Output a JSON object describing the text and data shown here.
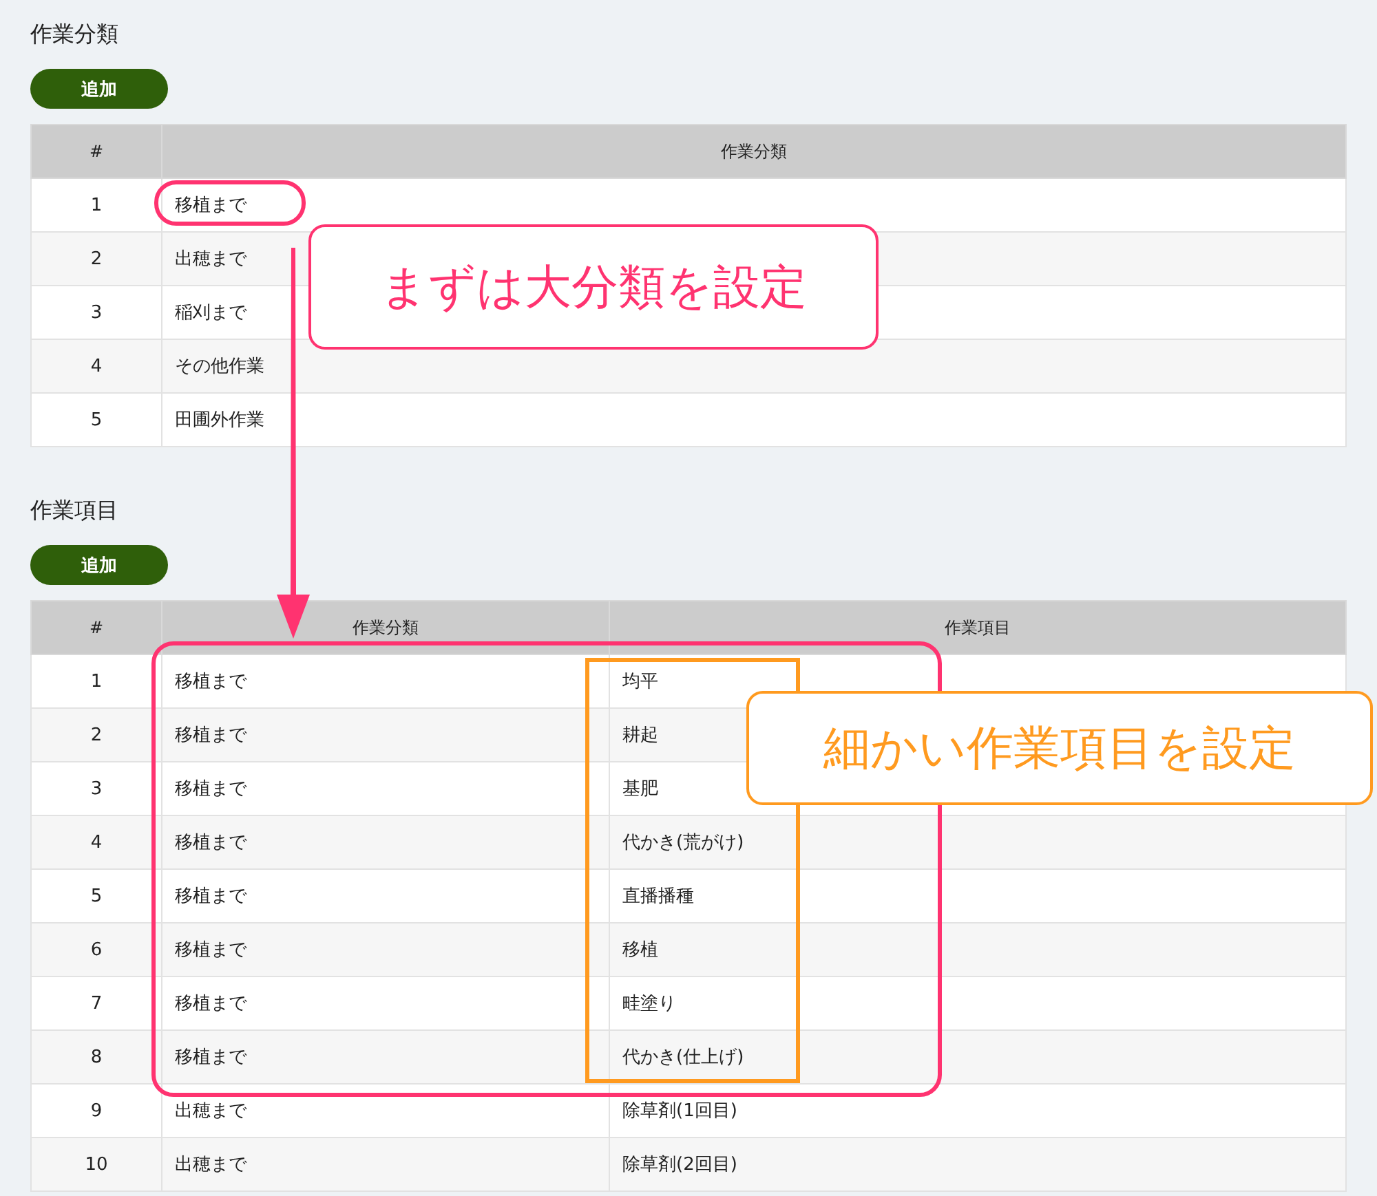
{
  "sections": [
    {
      "title": "作業分類",
      "add_button": "追加",
      "columns": [
        "#",
        "作業分類"
      ],
      "rows": [
        [
          "1",
          "移植まで"
        ],
        [
          "2",
          "出穂まで"
        ],
        [
          "3",
          "稲刈まで"
        ],
        [
          "4",
          "その他作業"
        ],
        [
          "5",
          "田圃外作業"
        ]
      ]
    },
    {
      "title": "作業項目",
      "add_button": "追加",
      "columns": [
        "#",
        "作業分類",
        "作業項目"
      ],
      "rows": [
        [
          "1",
          "移植まで",
          "均平"
        ],
        [
          "2",
          "移植まで",
          "耕起"
        ],
        [
          "3",
          "移植まで",
          "基肥"
        ],
        [
          "4",
          "移植まで",
          "代かき(荒がけ)"
        ],
        [
          "5",
          "移植まで",
          "直播播種"
        ],
        [
          "6",
          "移植まで",
          "移植"
        ],
        [
          "7",
          "移植まで",
          "畦塗り"
        ],
        [
          "8",
          "移植まで",
          "代かき(仕上げ)"
        ],
        [
          "9",
          "出穂まで",
          "除草剤(1回目)"
        ],
        [
          "10",
          "出穂まで",
          "除草剤(2回目)"
        ]
      ]
    }
  ],
  "annotations": [
    {
      "text": "まずは大分類を設定",
      "color": "#ff3370"
    },
    {
      "text": "細かい作業項目を設定",
      "color": "#ff9a1f"
    }
  ]
}
